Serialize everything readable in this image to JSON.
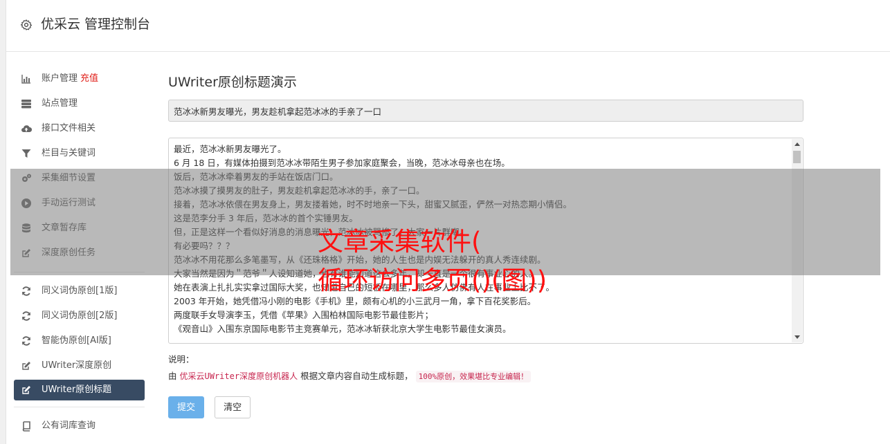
{
  "header": {
    "icon": "gear-icon",
    "title": "优采云 管理控制台"
  },
  "sidebar": {
    "groups": [
      [
        {
          "label": "账户管理",
          "badge": "充值",
          "icon": "bar-chart-icon"
        },
        {
          "label": "站点管理",
          "icon": "server-icon"
        },
        {
          "label": "接口文件相关",
          "icon": "cloud-upload-icon"
        },
        {
          "label": "栏目与关键词",
          "icon": "filter-icon"
        },
        {
          "label": "采集细节设置",
          "icon": "gears-icon"
        },
        {
          "label": "手动运行测试",
          "icon": "play-circle-icon"
        },
        {
          "label": "文章暂存库",
          "icon": "database-icon"
        },
        {
          "label": "深度原创任务",
          "icon": "edit-icon"
        }
      ],
      [
        {
          "label": "同义词伪原创[1版]",
          "icon": "refresh-icon"
        },
        {
          "label": "同义词伪原创[2版]",
          "icon": "refresh-icon"
        },
        {
          "label": "智能伪原创[AI版]",
          "icon": "refresh-icon"
        },
        {
          "label": "UWriter深度原创",
          "icon": "edit-icon"
        },
        {
          "label": "UWriter原创标题",
          "icon": "edit-icon",
          "active": true
        }
      ],
      [
        {
          "label": "公有词库查询",
          "icon": "book-icon"
        }
      ]
    ]
  },
  "main": {
    "page_title": "UWriter原创标题演示",
    "title_value": "范冰冰新男友曝光，男友趁机拿起范冰冰的手亲了一口",
    "body_lines": [
      "最近，范冰冰新男友曝光了。",
      "6 月 18 日，有媒体拍摄到范冰冰带陌生男子参加家庭聚会，当晚，范冰冰母亲也在场。",
      "饭后，范冰冰牵着男友的手站在饭店门口。",
      "范冰冰摸了摸男友的肚子，男友趁机拿起范冰冰的手，亲了一口。",
      "接着，范冰冰依偎在男友身上，男友搂着她，时不时地亲一下头，甜蜜又腻歪，俨然一对热恋期小情侣。",
      "这是范李分手 3 年后，范冰冰的首个实锤男友。",
      "但，正是这样一个看似好消息的消息曝光，范冰冰被骂惨了。大家一片群嘲。",
      "有必要吗？？？",
      "范冰冰不用花那么多笔墨写，从《还珠格格》开始，她的人生也是内娱无法躲开的真人秀连续剧。",
      "大家当然是因为＂范爷＂人设知道她，也有谁能知道这么多年，却一直是一个很有事业心的人。",
      "她在表演上扎扎实实拿过国际大奖，也知道自己的短板在哪里，那么多人仿佛有人在事业上比不了。",
      "2003 年开始，她凭借冯小刚的电影《手机》里，颇有心机的小三武月一角，拿下百花奖影后。",
      "两度联手女导演李玉，凭借《苹果》入围柏林国际电影节最佳影片；",
      "《观音山》入围东京国际电影节主竞赛单元，范冰冰斩获北京大学生电影节最佳女演员。"
    ],
    "help_label": "说明：",
    "help_prefix": "由",
    "help_highlight": "优采云UWriter深度原创机器人",
    "help_middle": "根据文章内容自动生成标题，",
    "help_pill": "100%原创，效果堪比专业编辑！",
    "submit_label": "提交",
    "clear_label": "清空"
  },
  "watermark": {
    "line1": "文章采集软件(",
    "line2": "循环访问多页()(图))"
  },
  "colors": {
    "sidebar_active": "#384b63",
    "badge": "#e0201a",
    "primary": "#6ab0ea",
    "watermark": "#ff1010"
  }
}
